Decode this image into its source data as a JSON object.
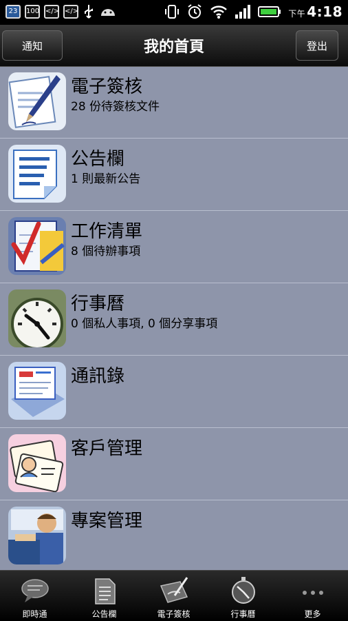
{
  "status_bar": {
    "icons": [
      "calendar-23-icon",
      "battery-100-icon",
      "code-icon",
      "code-icon",
      "usb-icon",
      "android-icon",
      "vibrate-icon",
      "alarm-icon",
      "wifi-icon",
      "signal-icon",
      "battery-icon"
    ],
    "calendar_day": "23",
    "battery_label": "100",
    "time_prefix": "下午",
    "time": "4:18"
  },
  "header": {
    "left_button": "通知",
    "title": "我的首頁",
    "right_button": "登出"
  },
  "list": {
    "items": [
      {
        "title": "電子簽核",
        "subtitle": "28 份待簽核文件",
        "icon": "pen-document-icon"
      },
      {
        "title": "公告欄",
        "subtitle": "1 則最新公告",
        "icon": "notice-document-icon"
      },
      {
        "title": "工作清單",
        "subtitle": "8 個待辦事項",
        "icon": "checklist-icon"
      },
      {
        "title": "行事曆",
        "subtitle": "0 個私人事項, 0 個分享事項",
        "icon": "clock-icon"
      },
      {
        "title": "通訊錄",
        "subtitle": "",
        "icon": "address-book-icon"
      },
      {
        "title": "客戶管理",
        "subtitle": "",
        "icon": "customer-card-icon"
      },
      {
        "title": "專案管理",
        "subtitle": "",
        "icon": "project-person-icon"
      }
    ]
  },
  "tabbar": {
    "tabs": [
      {
        "label": "即時通",
        "icon": "chat-bubble-icon"
      },
      {
        "label": "公告欄",
        "icon": "document-icon"
      },
      {
        "label": "電子簽核",
        "icon": "sign-document-icon"
      },
      {
        "label": "行事曆",
        "icon": "stopwatch-icon"
      },
      {
        "label": "更多",
        "icon": "more-dots-icon"
      }
    ]
  },
  "colors": {
    "list_background": "#8e95aa",
    "row_divider": "#b9bfcf",
    "header_dark": "#0c0c0c"
  }
}
